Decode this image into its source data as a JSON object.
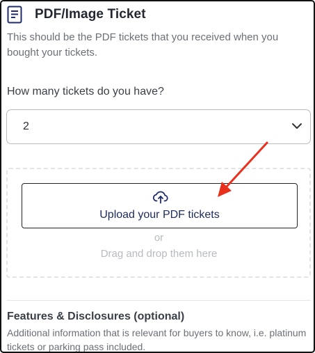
{
  "section": {
    "title": "PDF/Image Ticket",
    "subtitle": "This should be the PDF tickets that you received when you bought your tickets.",
    "icon": "document-icon"
  },
  "ticket_count": {
    "question": "How many tickets do you have?",
    "selected_value": "2"
  },
  "upload": {
    "button_label": "Upload your PDF tickets",
    "icon": "cloud-upload-icon",
    "or_text": "or",
    "drag_text": "Drag and drop them here"
  },
  "features": {
    "title": "Features & Disclosures (optional)",
    "description": "Additional information that is relevant for buyers to know, i.e. platinum tickets or parking pass included."
  },
  "colors": {
    "accent_navy": "#1d2a5c",
    "icon_blue": "#1f2b6b",
    "annotation_red": "#e8301c",
    "muted_text": "#b7bac0"
  }
}
